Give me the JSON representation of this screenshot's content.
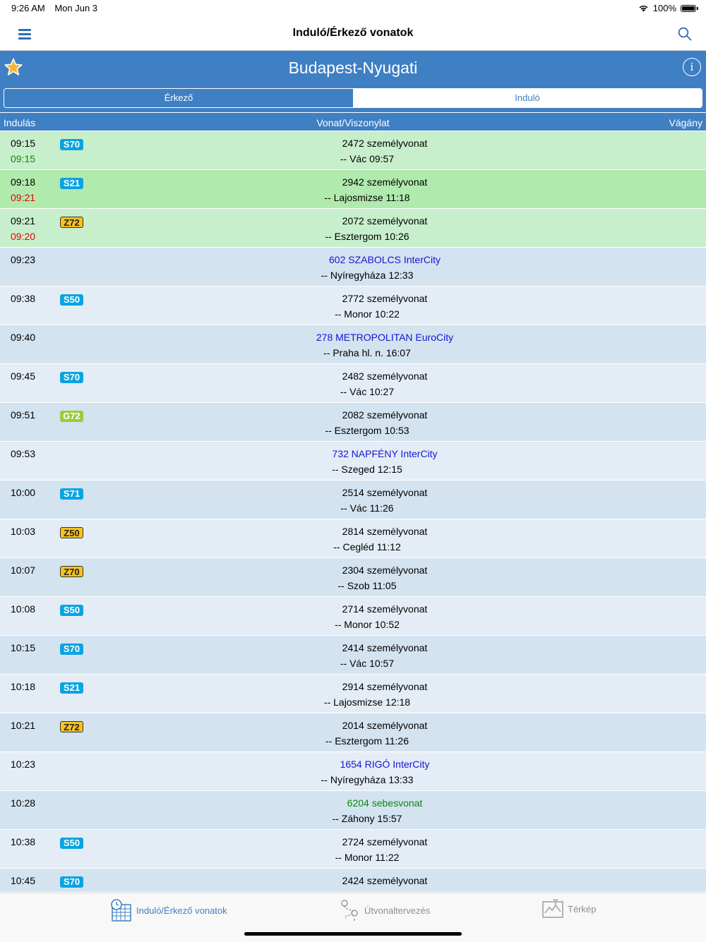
{
  "status": {
    "time": "9:26 AM",
    "date": "Mon Jun 3",
    "battery": "100%"
  },
  "nav": {
    "title": "Induló/Érkező vonatok",
    "menu_icon": "hamburger-icon",
    "search_icon": "search-icon"
  },
  "station": {
    "name": "Budapest-Nyugati",
    "favorite_icon": "star-icon",
    "info_icon": "info-icon"
  },
  "segments": {
    "arriving": "Érkező",
    "departing": "Induló",
    "selected": "arriving"
  },
  "columns": {
    "departure": "Indulás",
    "train": "Vonat/Viszonylat",
    "track": "Vágány"
  },
  "colors": {
    "header_blue": "#3f7fc4",
    "row_blue_dark": "#d3e3f0",
    "row_blue_light": "#e4edf5",
    "row_green_light": "#c8efcb",
    "row_green_dark": "#b1eaad",
    "late_red": "#e00000",
    "ontime_green": "#0b8a0b",
    "intercity_blue": "#1515d6",
    "fast_green": "#0b8a0b"
  },
  "trains": [
    {
      "time": "09:15",
      "actual": "09:15",
      "actual_color": "#0b8a0b",
      "line": "S70",
      "line_color": "#0aa4e0",
      "train": "2472 személyvonat",
      "train_color": "#000000",
      "dest": "-- Vác 09:57",
      "bg": "#c8efcb"
    },
    {
      "time": "09:18",
      "actual": "09:21",
      "actual_color": "#e00000",
      "line": "S21",
      "line_color": "#0aa4e0",
      "train": "2942 személyvonat",
      "train_color": "#000000",
      "dest": "-- Lajosmizse 11:18",
      "bg": "#b1eaad"
    },
    {
      "time": "09:21",
      "actual": "09:20",
      "actual_color": "#e00000",
      "line": "Z72",
      "line_color": "#f6c21c",
      "train": "2072 személyvonat",
      "train_color": "#000000",
      "dest": "-- Esztergom 10:26",
      "bg": "#c8efcb"
    },
    {
      "time": "09:23",
      "actual": "",
      "line": "",
      "train": "602 SZABOLCS InterCity",
      "train_color": "#1515d6",
      "dest": "-- Nyíregyháza 12:33",
      "bg": "#d3e3f0"
    },
    {
      "time": "09:38",
      "actual": "",
      "line": "S50",
      "line_color": "#0aa4e0",
      "train": "2772 személyvonat",
      "train_color": "#000000",
      "dest": "-- Monor 10:22",
      "bg": "#e4edf5"
    },
    {
      "time": "09:40",
      "actual": "",
      "line": "",
      "train": "278 METROPOLITAN EuroCity",
      "train_color": "#1515d6",
      "dest": "-- Praha hl. n. 16:07",
      "bg": "#d3e3f0"
    },
    {
      "time": "09:45",
      "actual": "",
      "line": "S70",
      "line_color": "#0aa4e0",
      "train": "2482 személyvonat",
      "train_color": "#000000",
      "dest": "-- Vác 10:27",
      "bg": "#e4edf5"
    },
    {
      "time": "09:51",
      "actual": "",
      "line": "G72",
      "line_color": "#9ccb3b",
      "train": "2082 személyvonat",
      "train_color": "#000000",
      "dest": "-- Esztergom 10:53",
      "bg": "#d3e3f0"
    },
    {
      "time": "09:53",
      "actual": "",
      "line": "",
      "train": "732 NAPFÉNY InterCity",
      "train_color": "#1515d6",
      "dest": "-- Szeged 12:15",
      "bg": "#e4edf5"
    },
    {
      "time": "10:00",
      "actual": "",
      "line": "S71",
      "line_color": "#0aa4e0",
      "train": "2514 személyvonat",
      "train_color": "#000000",
      "dest": "-- Vác 11:26",
      "bg": "#d3e3f0"
    },
    {
      "time": "10:03",
      "actual": "",
      "line": "Z50",
      "line_color": "#f6c21c",
      "train": "2814 személyvonat",
      "train_color": "#000000",
      "dest": "-- Cegléd 11:12",
      "bg": "#e4edf5"
    },
    {
      "time": "10:07",
      "actual": "",
      "line": "Z70",
      "line_color": "#f6c21c",
      "train": "2304 személyvonat",
      "train_color": "#000000",
      "dest": "-- Szob 11:05",
      "bg": "#d3e3f0"
    },
    {
      "time": "10:08",
      "actual": "",
      "line": "S50",
      "line_color": "#0aa4e0",
      "train": "2714 személyvonat",
      "train_color": "#000000",
      "dest": "-- Monor 10:52",
      "bg": "#e4edf5"
    },
    {
      "time": "10:15",
      "actual": "",
      "line": "S70",
      "line_color": "#0aa4e0",
      "train": "2414 személyvonat",
      "train_color": "#000000",
      "dest": "-- Vác 10:57",
      "bg": "#d3e3f0"
    },
    {
      "time": "10:18",
      "actual": "",
      "line": "S21",
      "line_color": "#0aa4e0",
      "train": "2914 személyvonat",
      "train_color": "#000000",
      "dest": "-- Lajosmizse 12:18",
      "bg": "#e4edf5"
    },
    {
      "time": "10:21",
      "actual": "",
      "line": "Z72",
      "line_color": "#f6c21c",
      "train": "2014 személyvonat",
      "train_color": "#000000",
      "dest": "-- Esztergom 11:26",
      "bg": "#d3e3f0"
    },
    {
      "time": "10:23",
      "actual": "",
      "line": "",
      "train": "1654 RIGÓ InterCity",
      "train_color": "#1515d6",
      "dest": "-- Nyíregyháza 13:33",
      "bg": "#e4edf5"
    },
    {
      "time": "10:28",
      "actual": "",
      "line": "",
      "train": "6204 sebesvonat",
      "train_color": "#0b8a0b",
      "dest": "-- Záhony 15:57",
      "bg": "#d3e3f0"
    },
    {
      "time": "10:38",
      "actual": "",
      "line": "S50",
      "line_color": "#0aa4e0",
      "train": "2724 személyvonat",
      "train_color": "#000000",
      "dest": "-- Monor 11:22",
      "bg": "#e4edf5"
    },
    {
      "time": "10:45",
      "actual": "",
      "line": "S70",
      "line_color": "#0aa4e0",
      "train": "2424 személyvonat",
      "train_color": "#000000",
      "dest": "",
      "bg": "#d3e3f0"
    }
  ],
  "tabs": [
    {
      "label": "Induló/Érkező vonatok",
      "icon": "timetable-icon",
      "active": true
    },
    {
      "label": "Útvonaltervezés",
      "icon": "route-icon",
      "active": false
    },
    {
      "label": "Térkép",
      "icon": "map-icon",
      "active": false
    }
  ]
}
